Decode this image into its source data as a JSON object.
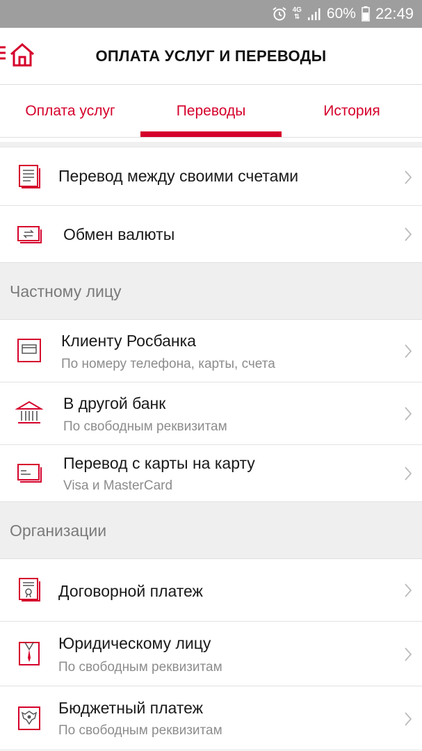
{
  "status_bar": {
    "network_top": "4G",
    "battery": "60%",
    "time": "22:49",
    "bg_color": "#9e9e9e"
  },
  "header": {
    "title": "ОПЛАТА УСЛУГ И ПЕРЕВОДЫ",
    "home_icon": "home-icon"
  },
  "tabs": [
    {
      "label": "Оплата услуг",
      "selected": false
    },
    {
      "label": "Переводы",
      "selected": true
    },
    {
      "label": "История",
      "selected": false
    }
  ],
  "accent_color": "#d5002b",
  "items_top": [
    {
      "icon": "document-icon",
      "title": "Перевод между своими счетами"
    },
    {
      "icon": "currency-exchange-icon",
      "title": "Обмен валюты"
    }
  ],
  "section_private": {
    "header": "Частному лицу",
    "items": [
      {
        "icon": "card-frame-icon",
        "title": "Клиенту Росбанка",
        "subtitle": "По номеру телефона, карты, счета"
      },
      {
        "icon": "bank-icon",
        "title": "В другой банк",
        "subtitle": "По свободным реквизитам"
      },
      {
        "icon": "card-icon",
        "title": "Перевод с карты на карту",
        "subtitle": "Visa и MasterCard"
      }
    ]
  },
  "section_org": {
    "header": "Организации",
    "items": [
      {
        "icon": "contract-icon",
        "title": "Договорной платеж"
      },
      {
        "icon": "business-suit-icon",
        "title": "Юридическому лицу",
        "subtitle": "По свободным реквизитам"
      },
      {
        "icon": "eagle-emblem-icon",
        "title": "Бюджетный платеж",
        "subtitle": "По свободным реквизитам"
      }
    ]
  }
}
